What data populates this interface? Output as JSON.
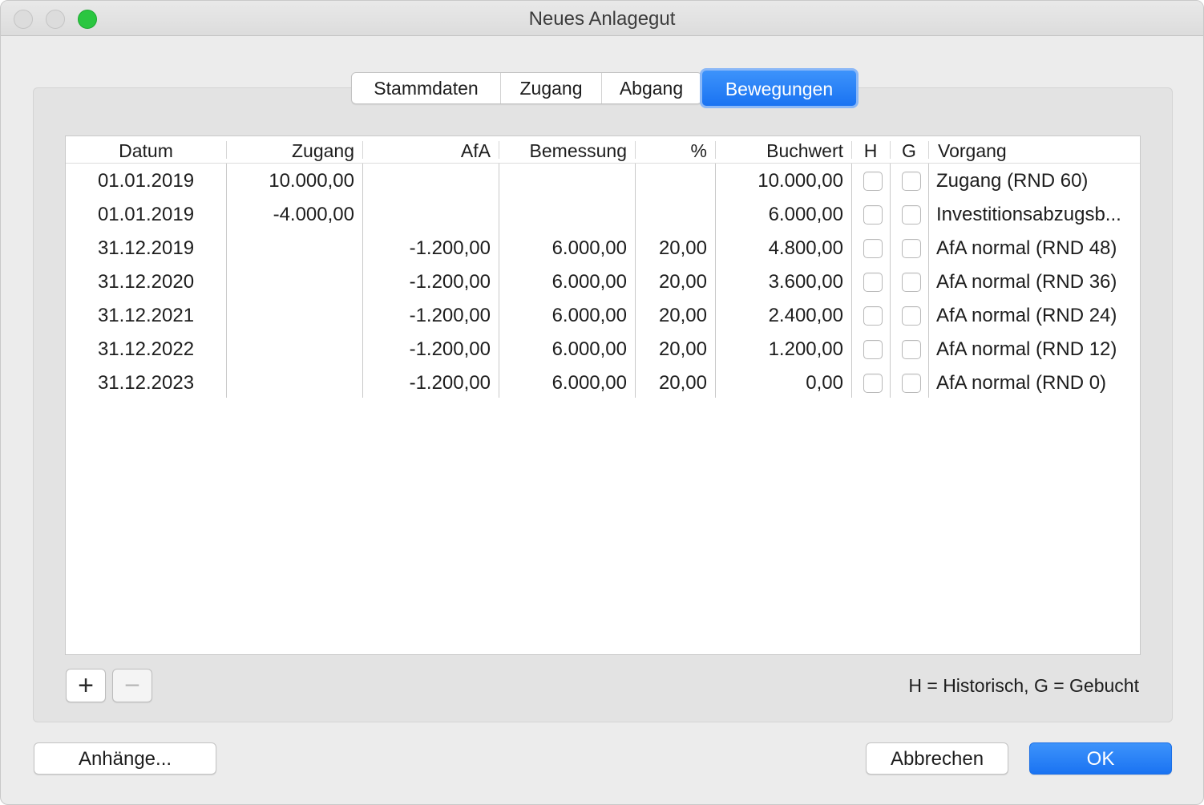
{
  "window": {
    "title": "Neues Anlagegut"
  },
  "tabs": [
    "Stammdaten",
    "Zugang",
    "Abgang",
    "Bewegungen"
  ],
  "active_tab": "Bewegungen",
  "table": {
    "columns": [
      "Datum",
      "Zugang",
      "AfA",
      "Bemessung",
      "%",
      "Buchwert",
      "H",
      "G",
      "Vorgang"
    ],
    "rows": [
      {
        "datum": "01.01.2019",
        "zugang": "10.000,00",
        "afa": "",
        "bemessung": "",
        "prozent": "",
        "buchwert": "10.000,00",
        "h": false,
        "g": false,
        "vorgang": "Zugang (RND 60)"
      },
      {
        "datum": "01.01.2019",
        "zugang": "-4.000,00",
        "afa": "",
        "bemessung": "",
        "prozent": "",
        "buchwert": "6.000,00",
        "h": false,
        "g": false,
        "vorgang": "Investitionsabzugsb..."
      },
      {
        "datum": "31.12.2019",
        "zugang": "",
        "afa": "-1.200,00",
        "bemessung": "6.000,00",
        "prozent": "20,00",
        "buchwert": "4.800,00",
        "h": false,
        "g": false,
        "vorgang": "AfA normal (RND 48)"
      },
      {
        "datum": "31.12.2020",
        "zugang": "",
        "afa": "-1.200,00",
        "bemessung": "6.000,00",
        "prozent": "20,00",
        "buchwert": "3.600,00",
        "h": false,
        "g": false,
        "vorgang": "AfA normal (RND 36)"
      },
      {
        "datum": "31.12.2021",
        "zugang": "",
        "afa": "-1.200,00",
        "bemessung": "6.000,00",
        "prozent": "20,00",
        "buchwert": "2.400,00",
        "h": false,
        "g": false,
        "vorgang": "AfA normal (RND 24)"
      },
      {
        "datum": "31.12.2022",
        "zugang": "",
        "afa": "-1.200,00",
        "bemessung": "6.000,00",
        "prozent": "20,00",
        "buchwert": "1.200,00",
        "h": false,
        "g": false,
        "vorgang": "AfA normal (RND 12)"
      },
      {
        "datum": "31.12.2023",
        "zugang": "",
        "afa": "-1.200,00",
        "bemessung": "6.000,00",
        "prozent": "20,00",
        "buchwert": "0,00",
        "h": false,
        "g": false,
        "vorgang": "AfA normal (RND 0)"
      }
    ]
  },
  "toolbar": {
    "add_label": "+",
    "remove_label": "−"
  },
  "legend": "H = Historisch, G = Gebucht",
  "buttons": {
    "attachments": "Anhänge...",
    "cancel": "Abbrechen",
    "ok": "OK"
  },
  "colors": {
    "accent": "#1a73f2",
    "traffic_zoom": "#2ac640"
  }
}
